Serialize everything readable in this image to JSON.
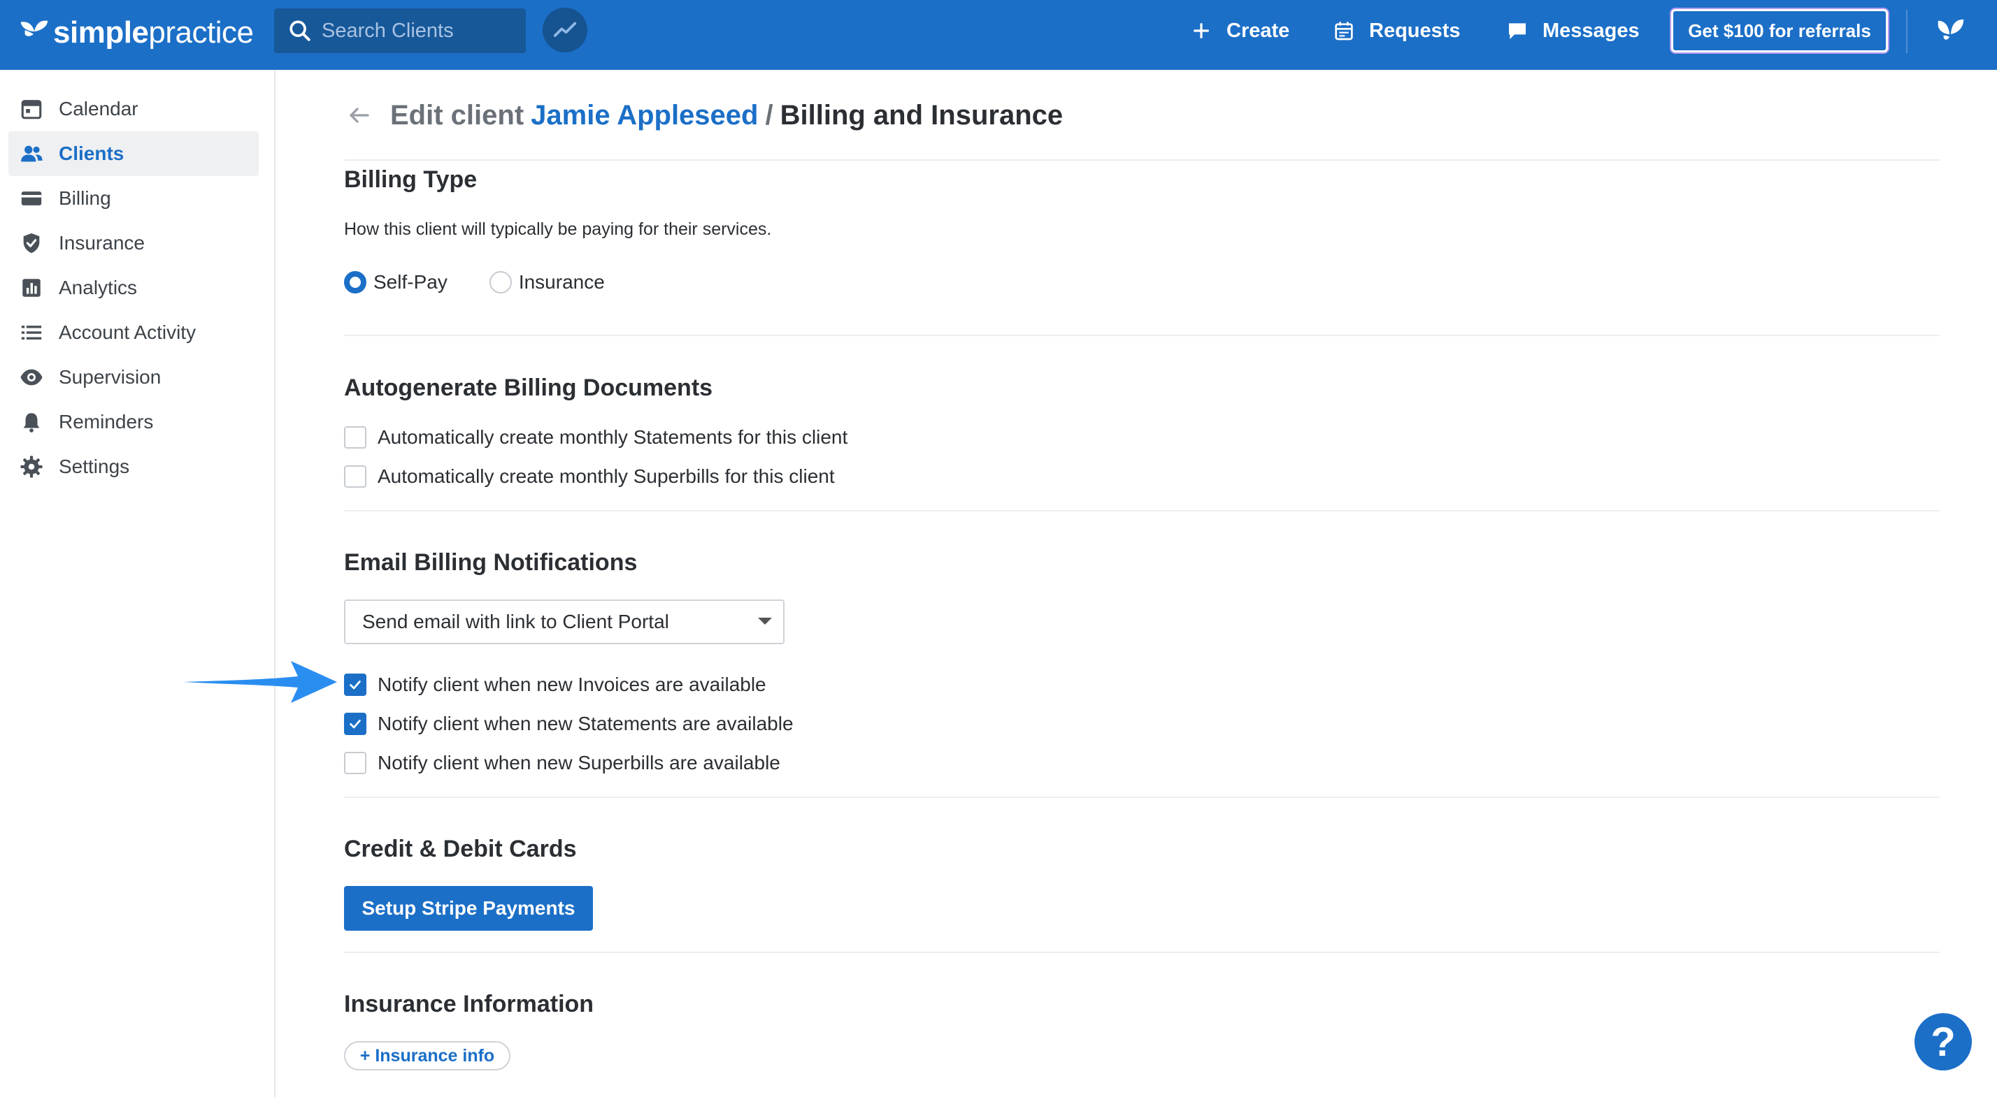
{
  "brand": {
    "name_bold": "simple",
    "name_light": "practice"
  },
  "topbar": {
    "search_placeholder": "Search Clients",
    "create_label": "Create",
    "requests_label": "Requests",
    "messages_label": "Messages",
    "referral_label": "Get $100 for referrals"
  },
  "sidebar": {
    "items": [
      {
        "label": "Calendar",
        "icon": "calendar-icon"
      },
      {
        "label": "Clients",
        "icon": "users-icon",
        "active": true
      },
      {
        "label": "Billing",
        "icon": "credit-card-icon"
      },
      {
        "label": "Insurance",
        "icon": "shield-icon"
      },
      {
        "label": "Analytics",
        "icon": "bar-chart-icon"
      },
      {
        "label": "Account Activity",
        "icon": "list-icon"
      },
      {
        "label": "Supervision",
        "icon": "eye-icon"
      },
      {
        "label": "Reminders",
        "icon": "bell-icon"
      },
      {
        "label": "Settings",
        "icon": "gear-icon"
      }
    ]
  },
  "header": {
    "prefix": "Edit client",
    "client_name": "Jamie Appleseed",
    "separator": "/",
    "page": "Billing and Insurance"
  },
  "billing_type": {
    "title": "Billing Type",
    "helper": "How this client will typically be paying for their services.",
    "options": [
      {
        "label": "Self-Pay",
        "selected": true
      },
      {
        "label": "Insurance",
        "selected": false
      }
    ]
  },
  "autogenerate": {
    "title": "Autogenerate Billing Documents",
    "options": [
      {
        "label": "Automatically create monthly Statements for this client",
        "checked": false
      },
      {
        "label": "Automatically create monthly Superbills for this client",
        "checked": false
      }
    ]
  },
  "email_notifications": {
    "title": "Email Billing Notifications",
    "selected": "Send email with link to Client Portal",
    "options": [
      {
        "label": "Notify client when new Invoices are available",
        "checked": true
      },
      {
        "label": "Notify client when new Statements are available",
        "checked": true
      },
      {
        "label": "Notify client when new Superbills are available",
        "checked": false
      }
    ]
  },
  "cards": {
    "title": "Credit & Debit Cards",
    "button": "Setup Stripe Payments"
  },
  "insurance_info": {
    "title": "Insurance Information",
    "button": "+ Insurance info"
  },
  "help": {
    "label": "?"
  },
  "colors": {
    "primary": "#1b6fc7",
    "topbar": "#1b6fc7",
    "annotation_arrow": "#2a8ef0"
  }
}
